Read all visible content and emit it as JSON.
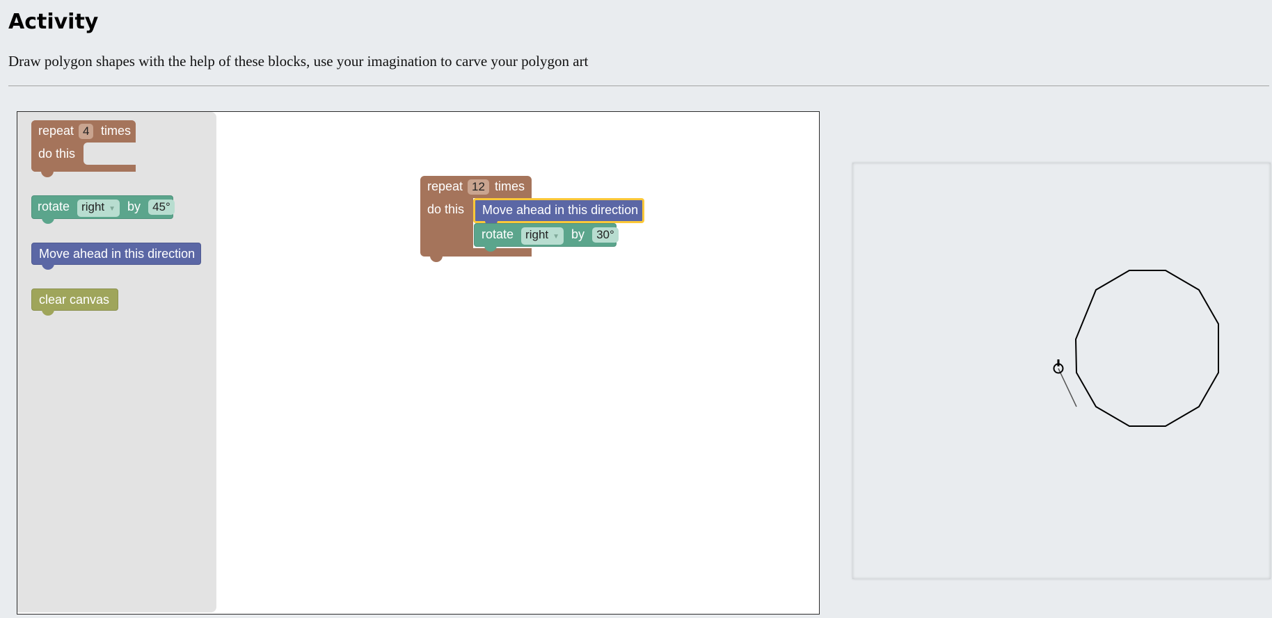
{
  "page": {
    "title": "Activity",
    "description": "Draw polygon shapes with the help of these blocks, use your imagination to carve your polygon art"
  },
  "toolbox": {
    "repeat_block": {
      "label_repeat": "repeat",
      "count": "4",
      "label_times": "times",
      "label_do": "do this"
    },
    "rotate_block": {
      "label_rotate": "rotate",
      "direction": "right",
      "label_by": "by",
      "angle": "45°"
    },
    "move_block": {
      "label": "Move ahead in this direction"
    },
    "clear_block": {
      "label": "clear canvas"
    }
  },
  "program": {
    "repeat_block": {
      "label_repeat": "repeat",
      "count": "12",
      "label_times": "times",
      "label_do": "do this"
    },
    "move_block": {
      "label": "Move ahead in this direction",
      "selected": true
    },
    "rotate_block": {
      "label_rotate": "rotate",
      "direction": "right",
      "label_by": "by",
      "angle": "30°"
    }
  },
  "drawing": {
    "shape": "regular polygon",
    "sides": 12,
    "stroke_color": "#000000",
    "turtle_icon": "turtle-cursor-icon"
  },
  "colors": {
    "repeat": "#a5745b",
    "rotate": "#5ba58c",
    "move": "#5b67a5",
    "clear": "#9fa55b",
    "selection": "#fcc838",
    "page_background": "#e9ecef"
  }
}
